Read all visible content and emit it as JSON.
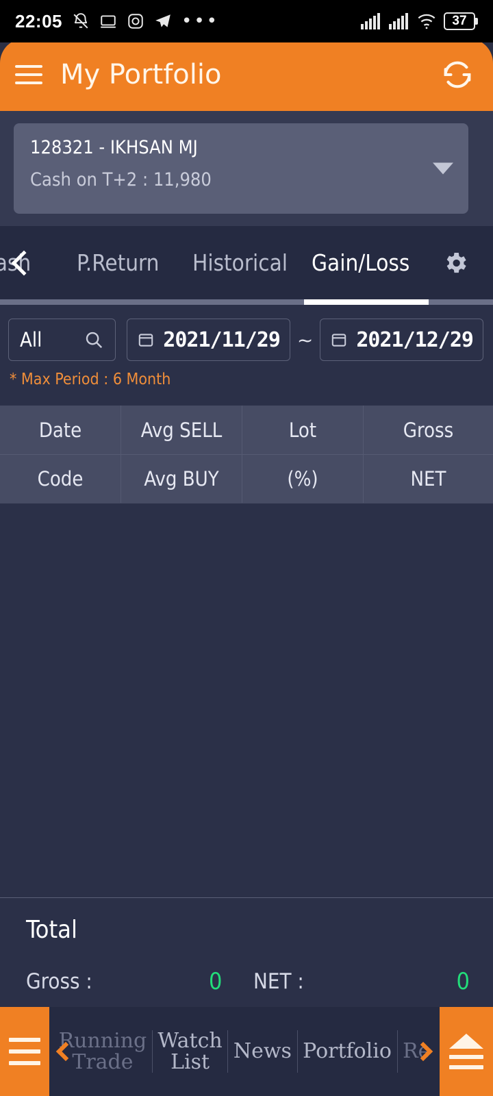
{
  "status_bar": {
    "time": "22:05",
    "left_icons": [
      "bell-muted-icon",
      "monitor-icon",
      "instagram-icon",
      "telegram-icon",
      "more-dots-icon"
    ],
    "right_icons": [
      "signal-bars-icon",
      "signal-bars-icon",
      "wifi-icon",
      "battery-icon"
    ],
    "battery_level": "37"
  },
  "appbar": {
    "menu_icon": "hamburger-menu-icon",
    "title": "My Portfolio",
    "refresh_icon": "refresh-icon",
    "background": "#f08023"
  },
  "account": {
    "name": "128321 - IKHSAN MJ",
    "cash_label": "Cash on T+2 : 11,980",
    "caret_icon": "chevron-down-icon"
  },
  "tabs": {
    "items": [
      {
        "label": "Cash",
        "active": false
      },
      {
        "label": "P.Return",
        "active": false
      },
      {
        "label": "Historical",
        "active": false
      },
      {
        "label": "Gain/Loss",
        "active": true
      }
    ],
    "scroll_left_icon": "chevron-left-icon",
    "settings_icon": "gear-icon"
  },
  "filters": {
    "search_value": "All",
    "search_icon": "search-icon",
    "date_from": "2021/11/29",
    "date_to": "2021/12/29",
    "range_separator": "~",
    "calendar_icon": "calendar-icon",
    "note": "* Max Period : 6 Month",
    "note_color": "#f08e3a"
  },
  "table": {
    "header_row_1": [
      "Date",
      "Avg SELL",
      "Lot",
      "Gross"
    ],
    "header_row_2": [
      "Code",
      "Avg BUY",
      "(%)",
      "NET"
    ],
    "rows": []
  },
  "total": {
    "title": "Total",
    "gross_label": "Gross :",
    "gross_value": "0",
    "net_label": "NET :",
    "net_value": "0",
    "value_color": "#22dd7a"
  },
  "bottom_nav": {
    "left_menu_icon": "hamburger-menu-icon",
    "prev_icon": "chevron-left-icon",
    "next_icon": "chevron-right-icon",
    "items": [
      {
        "label": "Running\nTrade",
        "cut": true
      },
      {
        "label": "Watch\nList",
        "cut": false
      },
      {
        "label": "News",
        "cut": false
      },
      {
        "label": "Portfolio",
        "cut": false
      },
      {
        "label": "Re",
        "cut": true
      }
    ],
    "right_icon": "eject-panel-icon"
  }
}
